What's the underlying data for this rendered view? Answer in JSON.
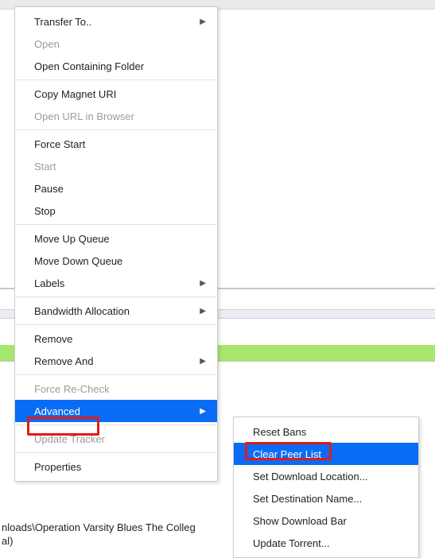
{
  "main_menu": {
    "transfer_to": "Transfer To..",
    "open": "Open",
    "open_folder": "Open Containing Folder",
    "copy_magnet": "Copy Magnet URI",
    "open_url": "Open URL in Browser",
    "force_start": "Force Start",
    "start": "Start",
    "pause": "Pause",
    "stop": "Stop",
    "move_up": "Move Up Queue",
    "move_down": "Move Down Queue",
    "labels": "Labels",
    "bandwidth": "Bandwidth Allocation",
    "remove": "Remove",
    "remove_and": "Remove And",
    "force_recheck": "Force Re-Check",
    "advanced": "Advanced",
    "update_tracker": "Update Tracker",
    "properties": "Properties"
  },
  "sub_menu": {
    "reset_bans": "Reset Bans",
    "clear_peer": "Clear Peer List",
    "set_dl_loc": "Set Download Location...",
    "set_dest": "Set Destination Name...",
    "show_dl_bar": "Show Download Bar",
    "update_torrent": "Update Torrent..."
  },
  "path_fragment": "nloads\\Operation Varsity Blues The Colleg\nal)"
}
